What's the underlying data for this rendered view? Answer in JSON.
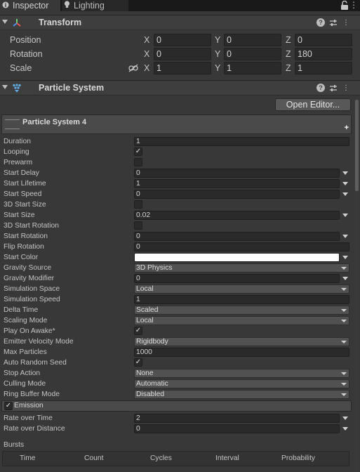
{
  "tabs": [
    {
      "label": "Inspector",
      "icon": "info-icon",
      "active": true
    },
    {
      "label": "Lighting",
      "icon": "lightbulb-icon",
      "active": false
    }
  ],
  "transform": {
    "title": "Transform",
    "position": {
      "label": "Position",
      "x": "0",
      "y": "0",
      "z": "0"
    },
    "rotation": {
      "label": "Rotation",
      "x": "0",
      "y": "0",
      "z": "180"
    },
    "scale": {
      "label": "Scale",
      "x": "1",
      "y": "1",
      "z": "1"
    },
    "axes": {
      "x": "X",
      "y": "Y",
      "z": "Z"
    }
  },
  "particle_system": {
    "title": "Particle System",
    "open_editor": "Open Editor...",
    "module_title": "Particle System 4",
    "properties": [
      {
        "label": "Duration",
        "kind": "text",
        "value": "1"
      },
      {
        "label": "Looping",
        "kind": "check",
        "value": "✓"
      },
      {
        "label": "Prewarm",
        "kind": "check",
        "value": ""
      },
      {
        "label": "Start Delay",
        "kind": "curve",
        "value": "0"
      },
      {
        "label": "Start Lifetime",
        "kind": "curve",
        "value": "1"
      },
      {
        "label": "Start Speed",
        "kind": "curve",
        "value": "0"
      },
      {
        "label": "3D Start Size",
        "kind": "check",
        "value": ""
      },
      {
        "label": "Start Size",
        "kind": "curve",
        "value": "0.02"
      },
      {
        "label": "3D Start Rotation",
        "kind": "check",
        "value": ""
      },
      {
        "label": "Start Rotation",
        "kind": "curve",
        "value": "0"
      },
      {
        "label": "Flip Rotation",
        "kind": "text",
        "value": "0"
      },
      {
        "label": "Start Color",
        "kind": "color",
        "value": ""
      },
      {
        "label": "Gravity Source",
        "kind": "dropdown",
        "value": "3D Physics"
      },
      {
        "label": "Gravity Modifier",
        "kind": "curve",
        "value": "0"
      },
      {
        "label": "Simulation Space",
        "kind": "dropdown",
        "value": "Local"
      },
      {
        "label": "Simulation Speed",
        "kind": "text",
        "value": "1"
      },
      {
        "label": "Delta Time",
        "kind": "dropdown",
        "value": "Scaled"
      },
      {
        "label": "Scaling Mode",
        "kind": "dropdown",
        "value": "Local"
      },
      {
        "label": "Play On Awake*",
        "kind": "check",
        "value": "✓"
      },
      {
        "label": "Emitter Velocity Mode",
        "kind": "dropdown",
        "value": "Rigidbody"
      },
      {
        "label": "Max Particles",
        "kind": "text",
        "value": "1000"
      },
      {
        "label": "Auto Random Seed",
        "kind": "check",
        "value": "✓"
      },
      {
        "label": "Stop Action",
        "kind": "dropdown",
        "value": "None"
      },
      {
        "label": "Culling Mode",
        "kind": "dropdown",
        "value": "Automatic"
      },
      {
        "label": "Ring Buffer Mode",
        "kind": "dropdown",
        "value": "Disabled"
      }
    ],
    "start_color": "#ffffff"
  },
  "emission": {
    "check": "✓",
    "title": "Emission",
    "rate_over_time": {
      "label": "Rate over Time",
      "value": "2"
    },
    "rate_over_distance": {
      "label": "Rate over Distance",
      "value": "0"
    },
    "bursts_label": "Bursts",
    "bursts_columns": [
      "Time",
      "Count",
      "Cycles",
      "Interval",
      "Probability"
    ]
  },
  "colors": {
    "background": "#383838",
    "field": "#2a2a2a",
    "header": "#3e3e3e",
    "text": "#c4c4c4"
  }
}
